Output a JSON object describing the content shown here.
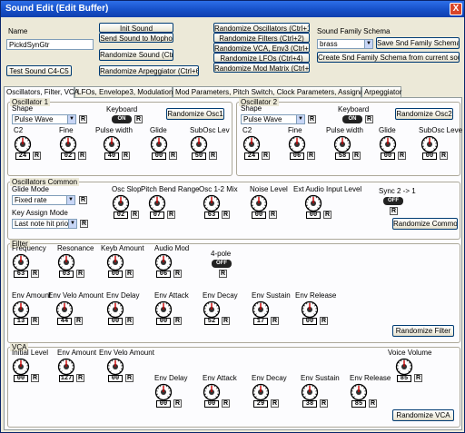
{
  "window": {
    "title": "Sound Edit (Edit Buffer)",
    "close_glyph": "X"
  },
  "top": {
    "name_label": "Name",
    "name_value": "PickdSynGtr",
    "init_sound": "Init Sound",
    "send_sound": "Send Sound to Mopho",
    "randomize_sound": "Randomize Sound (Ctrl+0)",
    "test_sound": "Test Sound C4-C5",
    "randomize_arp": "Randomize Arpeggiator (Ctrl+6)",
    "rand_osc": "Randomize Oscillators (Ctrl+1)",
    "rand_filters": "Randomize Filters (Ctrl+2)",
    "rand_vca": "Randomize VCA, Env3 (Ctrl+3)",
    "rand_lfos": "Randomize LFOs (Ctrl+4)",
    "rand_mod": "Randomize Mod Matrix (Ctrl+5)",
    "schema_label": "Sound Family Schema",
    "schema_value": "brass",
    "save_schema": "Save Snd Family Schema",
    "create_schema": "Create Snd Family Schema from current sound"
  },
  "tabs": [
    "Oscillators, Filter, VCA",
    "LFOs, Envelope3, Modulations",
    "Mod Parameters, Pitch Switch, Clock Parameters, Assignables",
    "Arpeggiator"
  ],
  "r": "R",
  "osc1": {
    "title": "Oscillator 1",
    "shape_label": "Shape",
    "shape_value": "Pulse Wave",
    "keyboard_label": "Keyboard",
    "keyboard_value": "ON",
    "randomize": "Randomize Osc1",
    "knobs": [
      {
        "label": "C2",
        "value": "24"
      },
      {
        "label": "Fine",
        "value": "02"
      },
      {
        "label": "Pulse width",
        "value": "40"
      },
      {
        "label": "Glide",
        "value": "00"
      },
      {
        "label": "SubOsc Lev",
        "value": "50"
      }
    ]
  },
  "osc2": {
    "title": "Oscillator 2",
    "shape_label": "Shape",
    "shape_value": "Pulse Wave",
    "keyboard_label": "Keyboard",
    "keyboard_value": "ON",
    "randomize": "Randomize Osc2",
    "knobs": [
      {
        "label": "C2",
        "value": "24"
      },
      {
        "label": "Fine",
        "value": "06"
      },
      {
        "label": "Pulse width",
        "value": "58"
      },
      {
        "label": "Glide",
        "value": "00"
      },
      {
        "label": "SubOsc Leve",
        "value": "00"
      }
    ]
  },
  "common": {
    "title": "Oscillators Common",
    "glide_label": "Glide Mode",
    "glide_value": "Fixed rate",
    "key_label": "Key Assign Mode",
    "key_value": "Last note hit priority",
    "sync_label": "Sync 2 -> 1",
    "sync_value": "OFF",
    "randomize": "Randomize Common",
    "knobs": [
      {
        "label": "Osc Slop",
        "value": "02"
      },
      {
        "label": "Pitch Bend Range",
        "value": "07"
      },
      {
        "label": "Osc 1-2 Mix",
        "value": "63"
      },
      {
        "label": "Noise Level",
        "value": "00"
      },
      {
        "label": "Ext Audio Input Level",
        "value": "00"
      }
    ]
  },
  "filter": {
    "title": "Filter",
    "pole_label": "4-pole",
    "pole_value": "OFF",
    "randomize": "Randomize Filter",
    "knobs_row1": [
      {
        "label": "Frequency",
        "value": "63"
      },
      {
        "label": "Resonance",
        "value": "03"
      },
      {
        "label": "Keyb Amount",
        "value": "00"
      },
      {
        "label": "Audio Mod",
        "value": "06"
      }
    ],
    "knobs_row2": [
      {
        "label": "Env Amount",
        "value": "13"
      },
      {
        "label": "Env Velo Amount",
        "value": "44"
      },
      {
        "label": "Env Delay",
        "value": "00"
      },
      {
        "label": "Env Attack",
        "value": "00"
      },
      {
        "label": "Env Decay",
        "value": "52"
      },
      {
        "label": "Env Sustain",
        "value": "17"
      },
      {
        "label": "Env Release",
        "value": "00"
      }
    ]
  },
  "vca": {
    "title": "VCA",
    "randomize": "Randomize VCA",
    "knobs_row1": [
      {
        "label": "Initial Level",
        "value": "00"
      },
      {
        "label": "Env Amount",
        "value": "127"
      },
      {
        "label": "Env Velo Amount",
        "value": "00"
      },
      {
        "label": "Voice Volume",
        "value": "85"
      }
    ],
    "knobs_row2": [
      {
        "label": "Env Delay",
        "value": "00"
      },
      {
        "label": "Env Attack",
        "value": "00"
      },
      {
        "label": "Env Decay",
        "value": "29"
      },
      {
        "label": "Env Sustain",
        "value": "38"
      },
      {
        "label": "Env Release",
        "value": "85"
      }
    ]
  }
}
